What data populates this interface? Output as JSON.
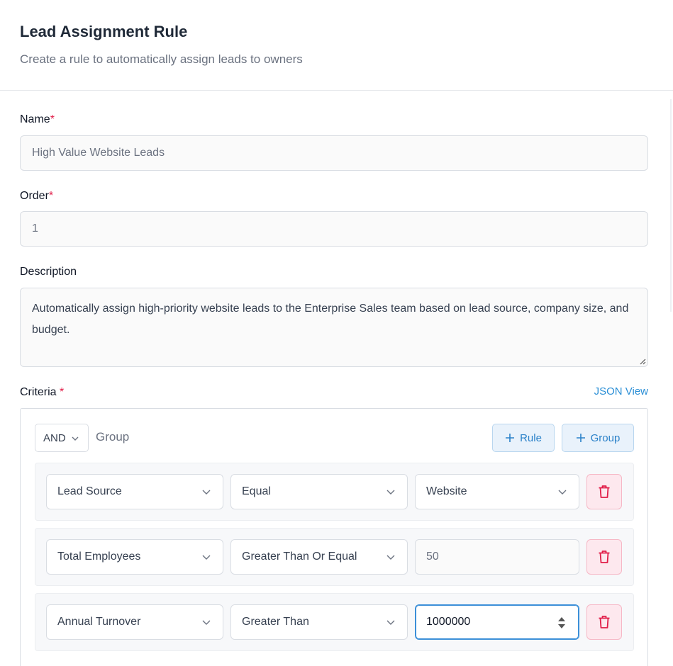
{
  "header": {
    "title": "Lead Assignment Rule",
    "subtitle": "Create a rule to automatically assign leads to owners"
  },
  "form": {
    "name_label": "Name",
    "name_value": "High Value Website Leads",
    "order_label": "Order",
    "order_value": "1",
    "description_label": "Description",
    "description_value": "Automatically assign high-priority website leads to the Enterprise Sales team based on lead source, company size, and budget.",
    "required_mark": "*",
    "criteria_label": "Criteria",
    "json_view_label": "JSON View"
  },
  "criteria": {
    "operator": "AND",
    "group_label": "Group",
    "add_rule_label": "Rule",
    "add_group_label": "Group",
    "rules": [
      {
        "field": "Lead Source",
        "condition": "Equal",
        "value": "Website",
        "value_type": "select"
      },
      {
        "field": "Total Employees",
        "condition": "Greater Than Or Equal",
        "value": "50",
        "value_type": "input"
      },
      {
        "field": "Annual Turnover",
        "condition": "Greater Than",
        "value": "1000000",
        "value_type": "number"
      }
    ]
  },
  "colors": {
    "accent": "#2b8fd6",
    "required": "#e11d48",
    "delete": "#e11d48",
    "delete_bg": "#fde8ee"
  },
  "icons": [
    "chevron-down-icon",
    "plus-icon",
    "trash-icon",
    "spinner-icon"
  ]
}
